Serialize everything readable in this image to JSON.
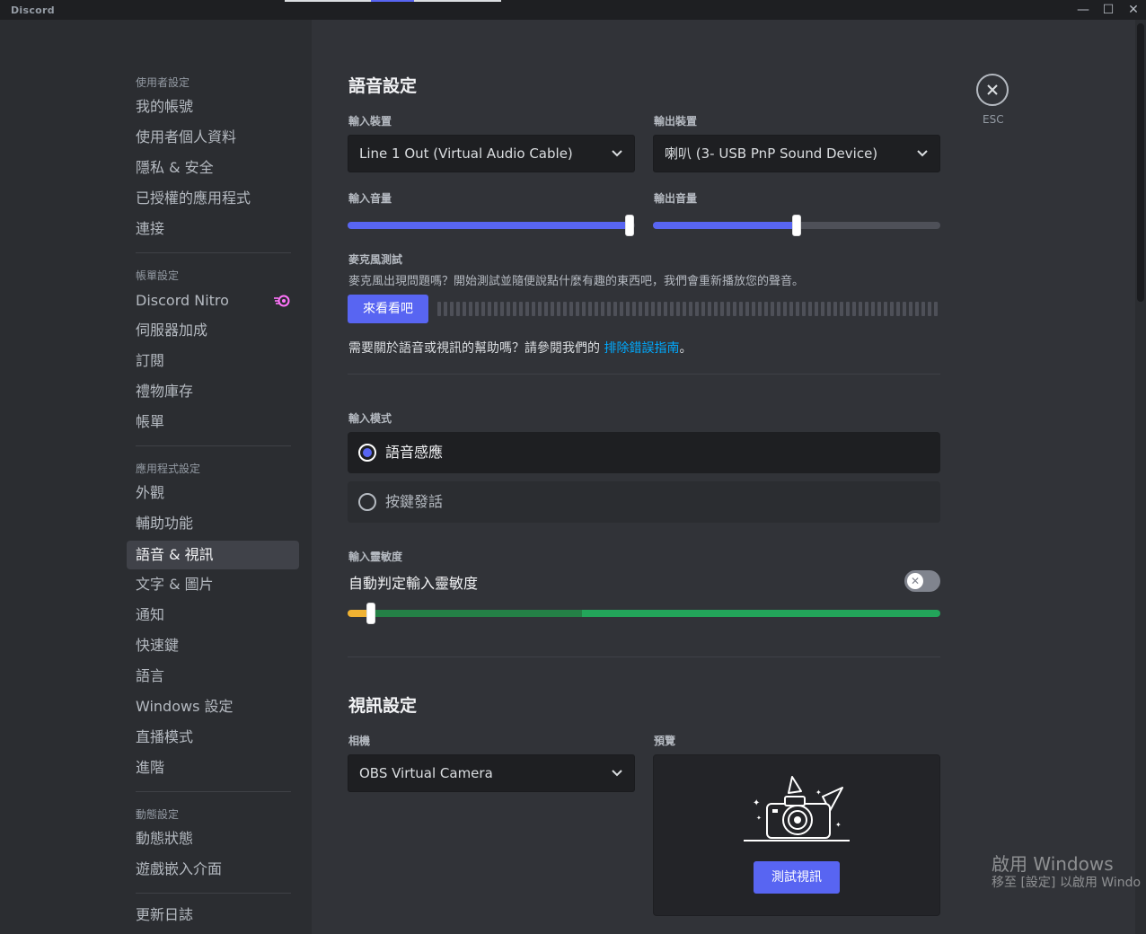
{
  "window": {
    "brand": "Discord",
    "controls": {
      "minimize": "—",
      "maximize": "☐",
      "close": "✕"
    }
  },
  "sidebar": {
    "sections": [
      {
        "header": "使用者設定",
        "items": [
          "我的帳號",
          "使用者個人資料",
          "隱私 & 安全",
          "已授權的應用程式",
          "連接"
        ]
      },
      {
        "header": "帳單設定",
        "items": [
          "Discord Nitro",
          "伺服器加成",
          "訂閱",
          "禮物庫存",
          "帳單"
        ]
      },
      {
        "header": "應用程式設定",
        "items": [
          "外觀",
          "輔助功能",
          "語音 & 視訊",
          "文字 & 圖片",
          "通知",
          "快速鍵",
          "語言",
          "Windows 設定",
          "直播模式",
          "進階"
        ]
      },
      {
        "header": "動態設定",
        "items": [
          "動態狀態",
          "遊戲嵌入介面"
        ]
      },
      {
        "header": "",
        "items": [
          "更新日誌"
        ]
      }
    ],
    "active_item": "語音 & 視訊"
  },
  "voice": {
    "title": "語音設定",
    "input_device_label": "輸入裝置",
    "input_device_value": "Line 1 Out (Virtual Audio Cable)",
    "output_device_label": "輸出裝置",
    "output_device_value": "喇叭 (3- USB PnP Sound Device)",
    "input_volume_label": "輸入音量",
    "input_volume_fraction": 0.98,
    "output_volume_label": "輸出音量",
    "output_volume_fraction": 0.5,
    "mic_test_label": "麥克風測試",
    "mic_test_desc": "麥克風出現問題嗎？開始測試並隨便說點什麼有趣的東西吧，我們會重新播放您的聲音。",
    "mic_test_button": "來看看吧",
    "help_prefix": "需要關於語音或視訊的幫助嗎？請參閱我們的",
    "help_link": "排除錯誤指南",
    "help_suffix": "。",
    "input_mode_label": "輸入模式",
    "modes": [
      "語音感應",
      "按鍵發話"
    ],
    "selected_mode": 0,
    "sensitivity_label": "輸入靈敏度",
    "auto_sensitivity_label": "自動判定輸入靈敏度",
    "auto_sensitivity_on": false,
    "sensitivity_fraction": 0.04,
    "toggle_off_glyph": "✕"
  },
  "video": {
    "title": "視訊設定",
    "camera_label": "相機",
    "camera_value": "OBS Virtual Camera",
    "preview_label": "預覽",
    "test_button": "測試視訊"
  },
  "close": {
    "esc_label": "ESC"
  },
  "watermark": {
    "title": "啟用 Windows",
    "subtitle": "移至 [設定] 以啟用 Windo"
  },
  "colors": {
    "accent": "#5865f2",
    "link": "#00a8fc",
    "nitro": "#ff73fa",
    "sensitivity_low": "#f0b232",
    "sensitivity_mid": "#248046",
    "sensitivity_high": "#23a55a"
  }
}
